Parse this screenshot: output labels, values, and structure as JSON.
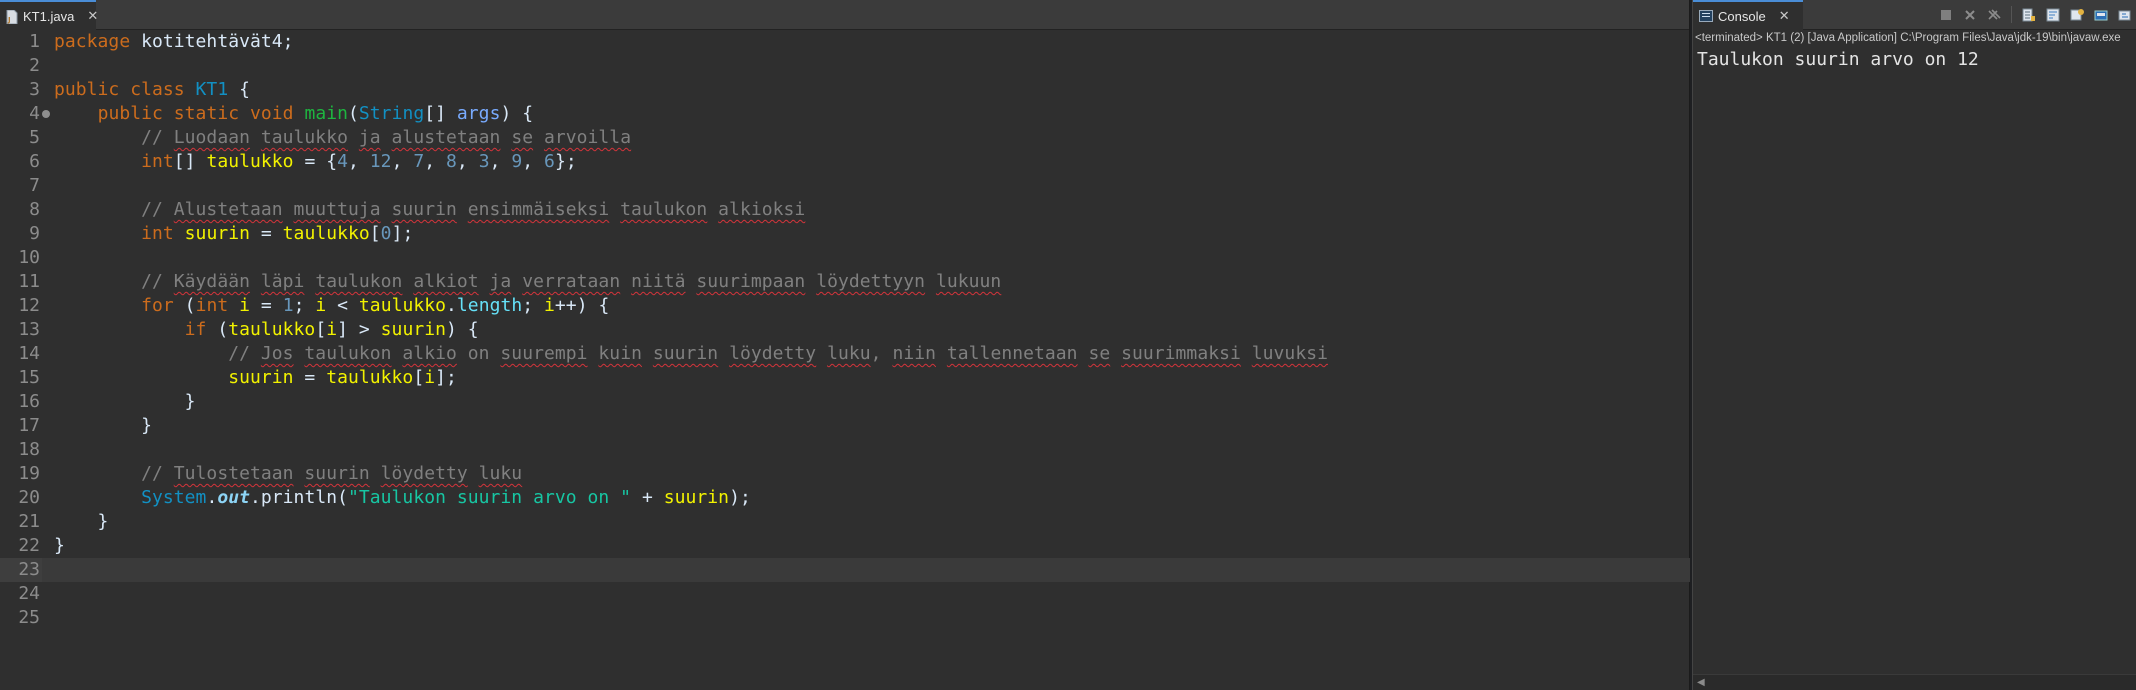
{
  "editor": {
    "tab_label": "KT1.java",
    "close_glyph": "✕",
    "icon": "java-file-icon"
  },
  "console": {
    "tab_label": "Console",
    "close_glyph": "✕",
    "status": "<terminated> KT1 (2) [Java Application] C:\\Program Files\\Java\\jdk-19\\bin\\javaw.exe",
    "output": "Taulukon suurin arvo on 12",
    "toolbar_icons": [
      "terminate-icon",
      "remove-launch-icon",
      "remove-all-icon",
      "scroll-lock-icon",
      "word-wrap-icon",
      "show-on-output-icon",
      "pin-console-icon",
      "open-console-icon"
    ]
  },
  "code": {
    "current_line": 23,
    "lines": [
      {
        "n": "1",
        "tokens": [
          {
            "t": "package",
            "c": "kw"
          },
          {
            "t": " kotitehtävät4;",
            "c": "plain"
          }
        ]
      },
      {
        "n": "2",
        "tokens": []
      },
      {
        "n": "3",
        "tokens": [
          {
            "t": "public",
            "c": "kw"
          },
          {
            "t": " ",
            "c": "plain"
          },
          {
            "t": "class",
            "c": "kw"
          },
          {
            "t": " ",
            "c": "plain"
          },
          {
            "t": "KT1",
            "c": "cls"
          },
          {
            "t": " {",
            "c": "plain"
          }
        ]
      },
      {
        "n": "4",
        "fold": true,
        "tokens": [
          {
            "t": "    ",
            "c": "plain"
          },
          {
            "t": "public",
            "c": "kw"
          },
          {
            "t": " ",
            "c": "plain"
          },
          {
            "t": "static",
            "c": "kw"
          },
          {
            "t": " ",
            "c": "plain"
          },
          {
            "t": "void",
            "c": "kw"
          },
          {
            "t": " ",
            "c": "plain"
          },
          {
            "t": "main",
            "c": "mth"
          },
          {
            "t": "(",
            "c": "plain"
          },
          {
            "t": "String",
            "c": "cls"
          },
          {
            "t": "[] ",
            "c": "plain"
          },
          {
            "t": "args",
            "c": "par"
          },
          {
            "t": ") {",
            "c": "plain"
          }
        ]
      },
      {
        "n": "5",
        "tokens": [
          {
            "t": "        // ",
            "c": "cmt"
          },
          {
            "t": "Luodaan",
            "c": "cmt sq"
          },
          {
            "t": " ",
            "c": "cmt"
          },
          {
            "t": "taulukko",
            "c": "cmt sq"
          },
          {
            "t": " ",
            "c": "cmt"
          },
          {
            "t": "ja",
            "c": "cmt sq"
          },
          {
            "t": " ",
            "c": "cmt"
          },
          {
            "t": "alustetaan",
            "c": "cmt sq"
          },
          {
            "t": " ",
            "c": "cmt"
          },
          {
            "t": "se",
            "c": "cmt sq"
          },
          {
            "t": " ",
            "c": "cmt"
          },
          {
            "t": "arvoilla",
            "c": "cmt sq"
          }
        ]
      },
      {
        "n": "6",
        "tokens": [
          {
            "t": "        ",
            "c": "plain"
          },
          {
            "t": "int",
            "c": "kw"
          },
          {
            "t": "[] ",
            "c": "plain"
          },
          {
            "t": "taulukko",
            "c": "var"
          },
          {
            "t": " = {",
            "c": "plain"
          },
          {
            "t": "4",
            "c": "num"
          },
          {
            "t": ", ",
            "c": "plain"
          },
          {
            "t": "12",
            "c": "num"
          },
          {
            "t": ", ",
            "c": "plain"
          },
          {
            "t": "7",
            "c": "num"
          },
          {
            "t": ", ",
            "c": "plain"
          },
          {
            "t": "8",
            "c": "num"
          },
          {
            "t": ", ",
            "c": "plain"
          },
          {
            "t": "3",
            "c": "num"
          },
          {
            "t": ", ",
            "c": "plain"
          },
          {
            "t": "9",
            "c": "num"
          },
          {
            "t": ", ",
            "c": "plain"
          },
          {
            "t": "6",
            "c": "num"
          },
          {
            "t": "};",
            "c": "plain"
          }
        ]
      },
      {
        "n": "7",
        "tokens": []
      },
      {
        "n": "8",
        "tokens": [
          {
            "t": "        // ",
            "c": "cmt"
          },
          {
            "t": "Alustetaan",
            "c": "cmt sq"
          },
          {
            "t": " ",
            "c": "cmt"
          },
          {
            "t": "muuttuja",
            "c": "cmt sq"
          },
          {
            "t": " ",
            "c": "cmt"
          },
          {
            "t": "suurin",
            "c": "cmt sq"
          },
          {
            "t": " ",
            "c": "cmt"
          },
          {
            "t": "ensimmäiseksi",
            "c": "cmt sq"
          },
          {
            "t": " ",
            "c": "cmt"
          },
          {
            "t": "taulukon",
            "c": "cmt sq"
          },
          {
            "t": " ",
            "c": "cmt"
          },
          {
            "t": "alkioksi",
            "c": "cmt sq"
          }
        ]
      },
      {
        "n": "9",
        "tokens": [
          {
            "t": "        ",
            "c": "plain"
          },
          {
            "t": "int",
            "c": "kw"
          },
          {
            "t": " ",
            "c": "plain"
          },
          {
            "t": "suurin",
            "c": "var"
          },
          {
            "t": " = ",
            "c": "plain"
          },
          {
            "t": "taulukko",
            "c": "var"
          },
          {
            "t": "[",
            "c": "plain"
          },
          {
            "t": "0",
            "c": "num"
          },
          {
            "t": "];",
            "c": "plain"
          }
        ]
      },
      {
        "n": "10",
        "tokens": []
      },
      {
        "n": "11",
        "tokens": [
          {
            "t": "        // ",
            "c": "cmt"
          },
          {
            "t": "Käydään",
            "c": "cmt sq"
          },
          {
            "t": " ",
            "c": "cmt"
          },
          {
            "t": "läpi",
            "c": "cmt sq"
          },
          {
            "t": " ",
            "c": "cmt"
          },
          {
            "t": "taulukon",
            "c": "cmt sq"
          },
          {
            "t": " ",
            "c": "cmt"
          },
          {
            "t": "alkiot",
            "c": "cmt sq"
          },
          {
            "t": " ",
            "c": "cmt"
          },
          {
            "t": "ja",
            "c": "cmt sq"
          },
          {
            "t": " ",
            "c": "cmt"
          },
          {
            "t": "verrataan",
            "c": "cmt sq"
          },
          {
            "t": " ",
            "c": "cmt"
          },
          {
            "t": "niitä",
            "c": "cmt sq"
          },
          {
            "t": " ",
            "c": "cmt"
          },
          {
            "t": "suurimpaan",
            "c": "cmt sq"
          },
          {
            "t": " ",
            "c": "cmt"
          },
          {
            "t": "löydettyyn",
            "c": "cmt sq"
          },
          {
            "t": " ",
            "c": "cmt"
          },
          {
            "t": "lukuun",
            "c": "cmt sq"
          }
        ]
      },
      {
        "n": "12",
        "tokens": [
          {
            "t": "        ",
            "c": "plain"
          },
          {
            "t": "for",
            "c": "kw"
          },
          {
            "t": " (",
            "c": "plain"
          },
          {
            "t": "int",
            "c": "kw"
          },
          {
            "t": " ",
            "c": "plain"
          },
          {
            "t": "i",
            "c": "var"
          },
          {
            "t": " = ",
            "c": "plain"
          },
          {
            "t": "1",
            "c": "num"
          },
          {
            "t": "; ",
            "c": "plain"
          },
          {
            "t": "i",
            "c": "var"
          },
          {
            "t": " < ",
            "c": "plain"
          },
          {
            "t": "taulukko",
            "c": "var"
          },
          {
            "t": ".",
            "c": "plain"
          },
          {
            "t": "length",
            "c": "fld"
          },
          {
            "t": "; ",
            "c": "plain"
          },
          {
            "t": "i",
            "c": "var"
          },
          {
            "t": "++) {",
            "c": "plain"
          }
        ]
      },
      {
        "n": "13",
        "tokens": [
          {
            "t": "            ",
            "c": "plain"
          },
          {
            "t": "if",
            "c": "kw"
          },
          {
            "t": " (",
            "c": "plain"
          },
          {
            "t": "taulukko",
            "c": "var"
          },
          {
            "t": "[",
            "c": "plain"
          },
          {
            "t": "i",
            "c": "var"
          },
          {
            "t": "] > ",
            "c": "plain"
          },
          {
            "t": "suurin",
            "c": "var"
          },
          {
            "t": ") {",
            "c": "plain"
          }
        ]
      },
      {
        "n": "14",
        "tokens": [
          {
            "t": "                // ",
            "c": "cmt"
          },
          {
            "t": "Jos",
            "c": "cmt sq"
          },
          {
            "t": " ",
            "c": "cmt"
          },
          {
            "t": "taulukon",
            "c": "cmt sq"
          },
          {
            "t": " ",
            "c": "cmt"
          },
          {
            "t": "alkio",
            "c": "cmt sq"
          },
          {
            "t": " on ",
            "c": "cmt"
          },
          {
            "t": "suurempi",
            "c": "cmt sq"
          },
          {
            "t": " ",
            "c": "cmt"
          },
          {
            "t": "kuin",
            "c": "cmt sq"
          },
          {
            "t": " ",
            "c": "cmt"
          },
          {
            "t": "suurin",
            "c": "cmt sq"
          },
          {
            "t": " ",
            "c": "cmt"
          },
          {
            "t": "löydetty",
            "c": "cmt sq"
          },
          {
            "t": " ",
            "c": "cmt"
          },
          {
            "t": "luku",
            "c": "cmt sq"
          },
          {
            "t": ", ",
            "c": "cmt"
          },
          {
            "t": "niin",
            "c": "cmt sq"
          },
          {
            "t": " ",
            "c": "cmt"
          },
          {
            "t": "tallennetaan",
            "c": "cmt sq"
          },
          {
            "t": " ",
            "c": "cmt"
          },
          {
            "t": "se",
            "c": "cmt sq"
          },
          {
            "t": " ",
            "c": "cmt"
          },
          {
            "t": "suurimmaksi",
            "c": "cmt sq"
          },
          {
            "t": " ",
            "c": "cmt"
          },
          {
            "t": "luvuksi",
            "c": "cmt sq"
          }
        ]
      },
      {
        "n": "15",
        "tokens": [
          {
            "t": "                ",
            "c": "plain"
          },
          {
            "t": "suurin",
            "c": "var"
          },
          {
            "t": " = ",
            "c": "plain"
          },
          {
            "t": "taulukko",
            "c": "var"
          },
          {
            "t": "[",
            "c": "plain"
          },
          {
            "t": "i",
            "c": "var"
          },
          {
            "t": "];",
            "c": "plain"
          }
        ]
      },
      {
        "n": "16",
        "tokens": [
          {
            "t": "            }",
            "c": "plain"
          }
        ]
      },
      {
        "n": "17",
        "tokens": [
          {
            "t": "        }",
            "c": "plain"
          }
        ]
      },
      {
        "n": "18",
        "tokens": []
      },
      {
        "n": "19",
        "tokens": [
          {
            "t": "        // ",
            "c": "cmt"
          },
          {
            "t": "Tulostetaan",
            "c": "cmt sq"
          },
          {
            "t": " ",
            "c": "cmt"
          },
          {
            "t": "suurin",
            "c": "cmt sq"
          },
          {
            "t": " ",
            "c": "cmt"
          },
          {
            "t": "löydetty",
            "c": "cmt sq"
          },
          {
            "t": " ",
            "c": "cmt"
          },
          {
            "t": "luku",
            "c": "cmt sq"
          }
        ]
      },
      {
        "n": "20",
        "tokens": [
          {
            "t": "        ",
            "c": "plain"
          },
          {
            "t": "System",
            "c": "cls"
          },
          {
            "t": ".",
            "c": "plain"
          },
          {
            "t": "out",
            "c": "sfld"
          },
          {
            "t": ".",
            "c": "plain"
          },
          {
            "t": "println",
            "c": "plain"
          },
          {
            "t": "(",
            "c": "plain"
          },
          {
            "t": "\"Taulukon suurin arvo on \"",
            "c": "str"
          },
          {
            "t": " + ",
            "c": "plain"
          },
          {
            "t": "suurin",
            "c": "var"
          },
          {
            "t": ");",
            "c": "plain"
          }
        ]
      },
      {
        "n": "21",
        "tokens": [
          {
            "t": "    }",
            "c": "plain"
          }
        ]
      },
      {
        "n": "22",
        "tokens": [
          {
            "t": "}",
            "c": "plain"
          }
        ]
      },
      {
        "n": "23",
        "tokens": []
      },
      {
        "n": "24",
        "tokens": []
      },
      {
        "n": "25",
        "tokens": []
      }
    ]
  }
}
